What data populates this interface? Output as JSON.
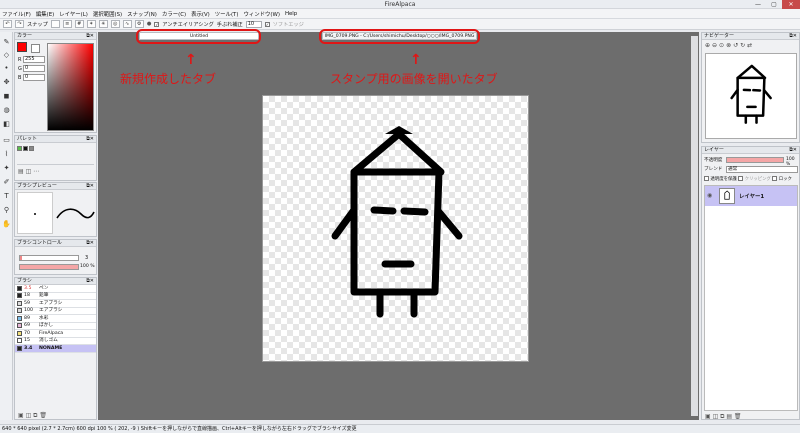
{
  "window": {
    "title": "FireAlpaca",
    "controls": [
      "—",
      "▢",
      "✕"
    ]
  },
  "menu": [
    "ファイル(F)",
    "編集(E)",
    "レイヤー(L)",
    "選択範囲(S)",
    "スナップ(N)",
    "カラー(C)",
    "表示(V)",
    "ツール(T)",
    "ウィンドウ(W)",
    "Help"
  ],
  "toolbar": {
    "snap_label": "スナップ",
    "antialias_label": "アンチエイリアシング",
    "correction_label": "手ぶれ補正",
    "correction_value": "10",
    "softedge_label": "ソフトエッジ"
  },
  "tabs": [
    {
      "label": "Untitled"
    },
    {
      "label": "IMG_0709.PNG - C:/Users/shimichu/Desktop/○○○/IMG_0709.PNG"
    }
  ],
  "annotations": {
    "left_label": "新規作成したタブ",
    "right_label": "スタンプ用の画像を開いたタブ",
    "arrow": "↑"
  },
  "panels": {
    "color": {
      "title": "カラー",
      "r_label": "R",
      "r_value": "255",
      "g_label": "G",
      "g_value": "0",
      "b_label": "B",
      "b_value": "0"
    },
    "palette": {
      "title": "パレット"
    },
    "brush_preview": {
      "title": "ブラシプレビュー"
    },
    "brush_control": {
      "title": "ブラシコントロール",
      "size_value": "3",
      "opacity_value": "100 %"
    },
    "brush": {
      "title": "ブラシ",
      "items": [
        {
          "size": "3.5",
          "name": "ペン",
          "color": "#222222"
        },
        {
          "size": "18",
          "name": "鉛筆",
          "color": "#222222"
        },
        {
          "size": "59",
          "name": "エアブラシ",
          "color": "#dddddd"
        },
        {
          "size": "100",
          "name": "エアブラシ",
          "color": "#dddddd"
        },
        {
          "size": "89",
          "name": "水彩",
          "color": "#7fc0ea"
        },
        {
          "size": "69",
          "name": "ぼかし",
          "color": "#e8b8d8"
        },
        {
          "size": "70",
          "name": "FireAlpaca",
          "color": "#f2e07a"
        },
        {
          "size": "15",
          "name": "消しゴム",
          "color": "#ffffff"
        },
        {
          "size": "3.4",
          "name": "NONAME",
          "color": "#222222"
        }
      ]
    },
    "navigator": {
      "title": "ナビゲーター"
    },
    "layer": {
      "title": "レイヤー",
      "opacity_label": "不透明度",
      "opacity_value": "100 %",
      "blend_label": "ブレンド",
      "blend_value": "通常",
      "protect_label": "透明度を保護",
      "clipping_label": "クリッピング",
      "lock_label": "ロック",
      "layer_name": "レイヤー1"
    }
  },
  "status": {
    "text": "640 * 640 pixel   (2.7 * 2.7cm)   600 dpi   100 %   ( 202, -9 )   Shiftキーを押しながらで直線描画、Ctrl+Altキーを押しながら左右ドラッグでブラシサイズ変更"
  },
  "colors": {
    "accent": "#e01616",
    "primary": "#ff0000",
    "layer_selected": "#c6c2f4"
  }
}
